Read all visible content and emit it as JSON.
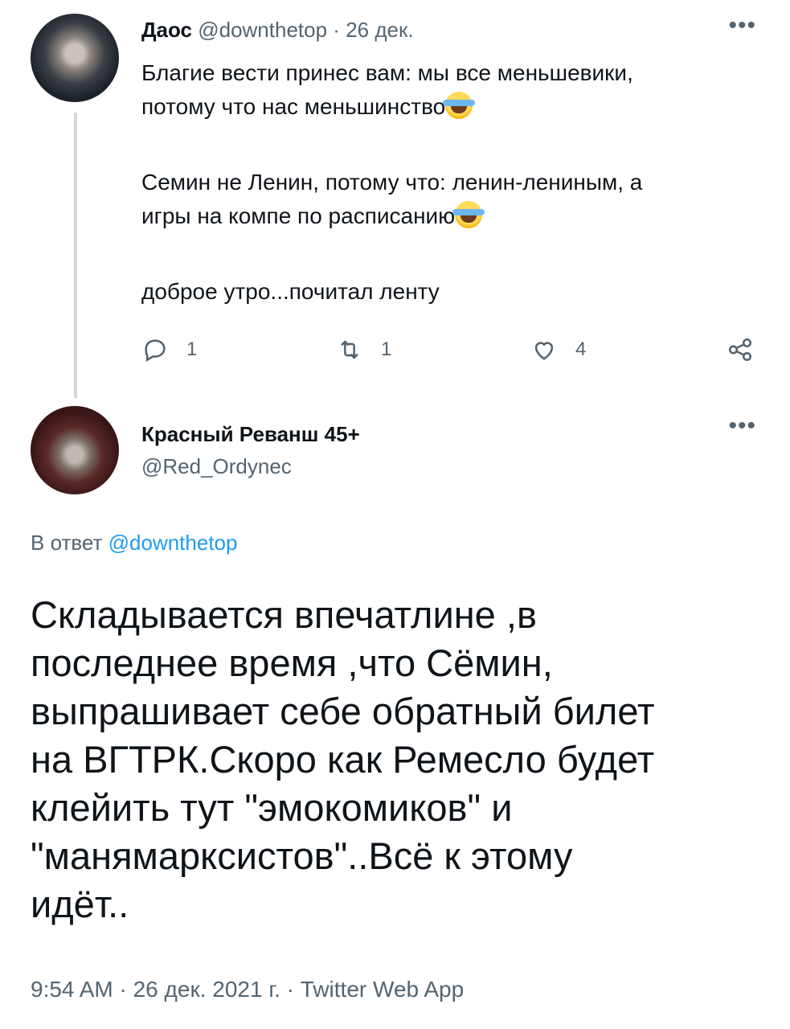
{
  "tweet1": {
    "name": "Даос",
    "handle": "@downthetop",
    "separator": "·",
    "date": "26 дек.",
    "more": "•••",
    "lines": [
      "Благие вести принес вам: мы все меньшевики,",
      "потому что нас меньшинство",
      "Семин не Ленин, потому что: ленин-лениным, а",
      "игры на компе по расписанию",
      "доброе утро...почитал ленту"
    ],
    "emoji_icon": "face-with-tears-of-joy",
    "actions": {
      "reply_count": "1",
      "retweet_count": "1",
      "like_count": "4"
    }
  },
  "tweet2": {
    "name": "Красный Реванш 45+",
    "handle": "@Red_Ordynec",
    "more": "•••",
    "reply_prefix": "В ответ",
    "reply_handle": "@downthetop",
    "text_lines": [
      "Складывается впечатлине ,в",
      "последнее время ,что Сёмин,",
      "выпрашивает себе обратный билет",
      "на ВГТРК.Скоро как Ремесло будет",
      "клейить тут \"эмокомиков\" и",
      "\"манямарксистов\"..Всё к этому",
      "идёт.."
    ],
    "meta": "9:54 AM · 26 дек. 2021 г. · Twitter Web App"
  },
  "colors": {
    "text": "#0f1419",
    "muted": "#536471",
    "link": "#1d9bf0",
    "thread_line": "#cfd9de"
  }
}
